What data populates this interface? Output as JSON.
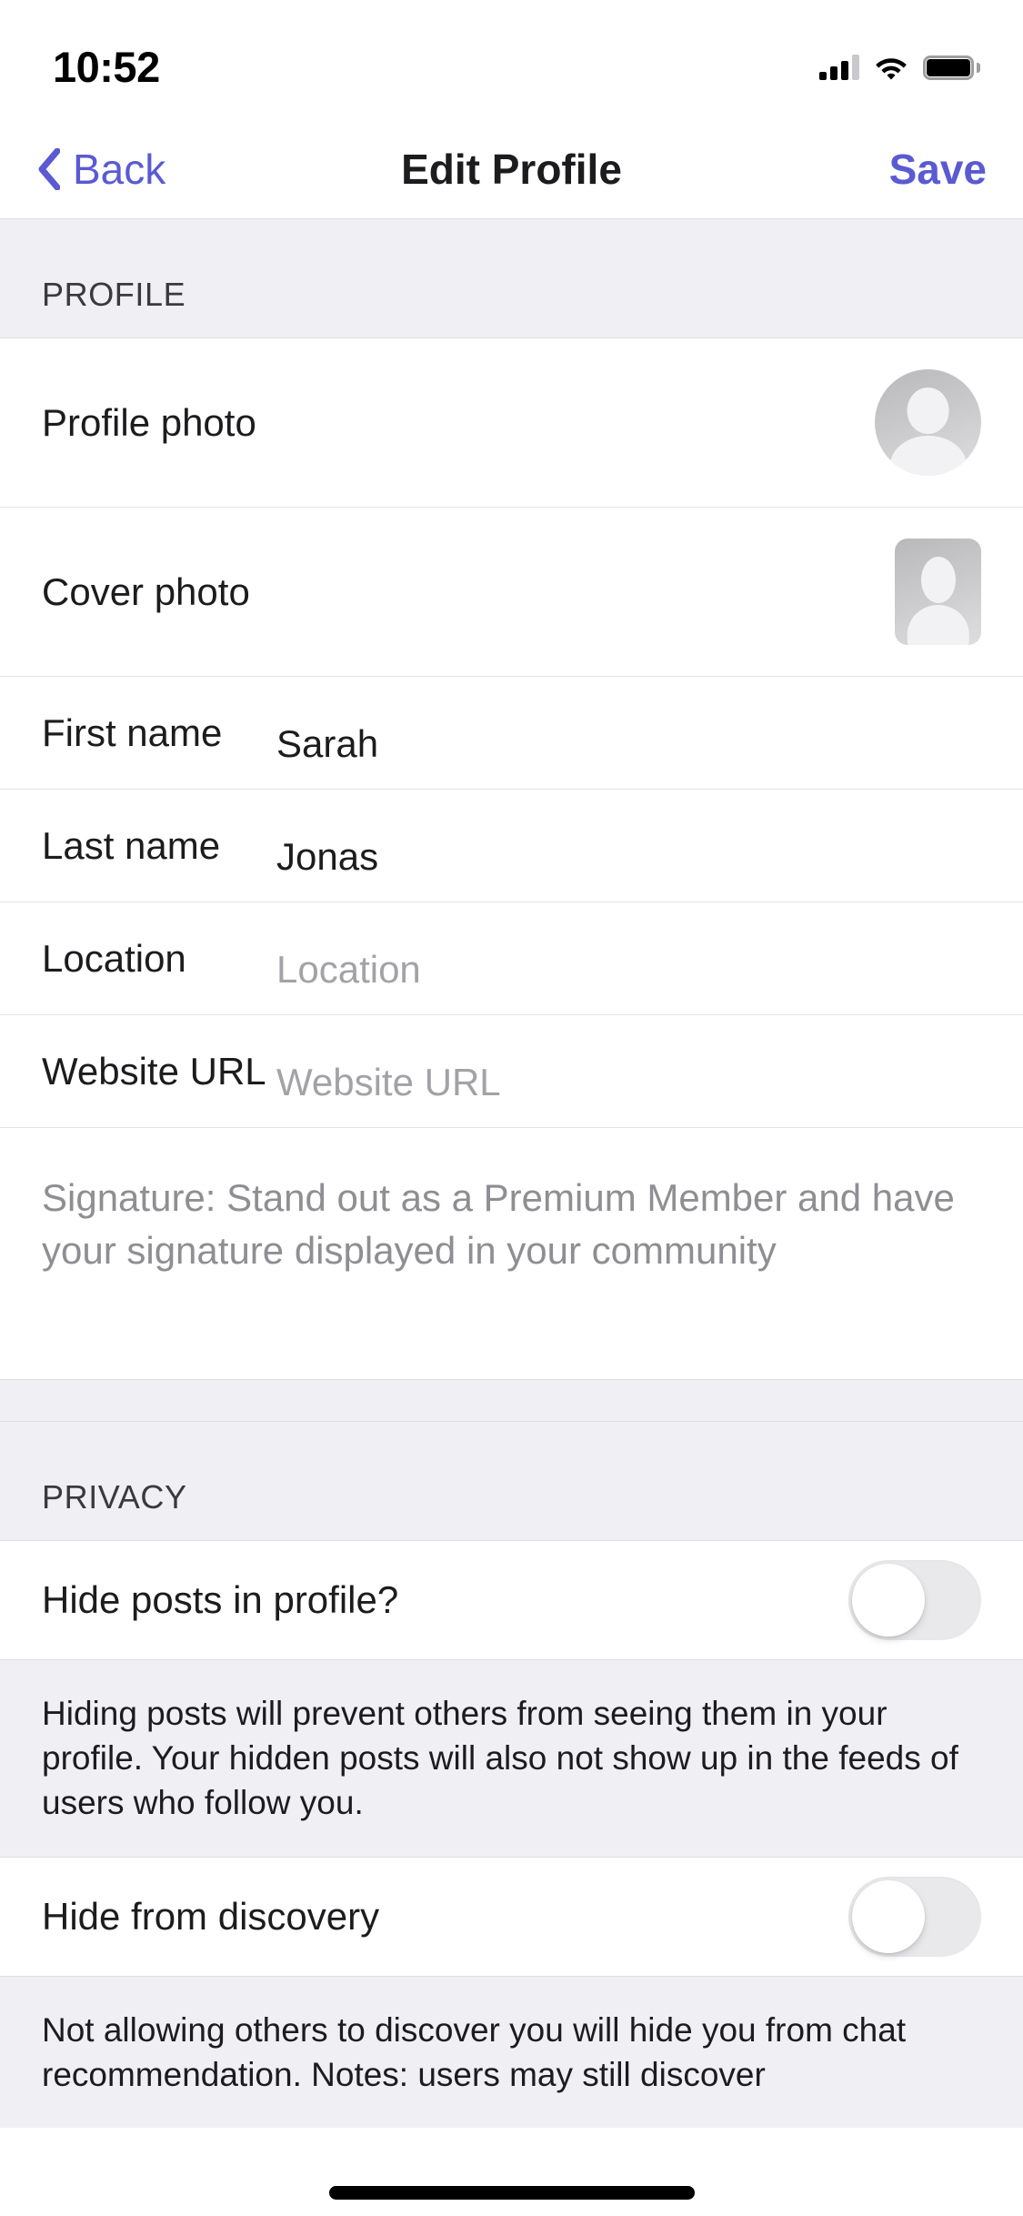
{
  "status_bar": {
    "time": "10:52",
    "signal_icon": "cellular-signal-icon",
    "wifi_icon": "wifi-icon",
    "battery_icon": "battery-full-icon"
  },
  "nav_bar": {
    "back_label": "Back",
    "back_icon": "chevron-left-icon",
    "title": "Edit Profile",
    "save_label": "Save",
    "accent_color": "#5a5ad2"
  },
  "profile_section": {
    "header": "PROFILE",
    "rows": [
      {
        "label": "Profile photo",
        "icon": "avatar-placeholder-circle-icon"
      },
      {
        "label": "Cover photo",
        "icon": "avatar-placeholder-rect-icon"
      }
    ],
    "fields": [
      {
        "label": "First name",
        "value": "Sarah",
        "placeholder": "First name"
      },
      {
        "label": "Last name",
        "value": "Jonas",
        "placeholder": "Last name"
      },
      {
        "label": "Location",
        "value": "",
        "placeholder": "Location"
      },
      {
        "label": "Website URL",
        "value": "",
        "placeholder": "Website URL"
      }
    ],
    "signature_placeholder": "Signature: Stand out as a Premium Member and have your signature displayed in your community"
  },
  "privacy_section": {
    "header": "PRIVACY",
    "items": [
      {
        "label": "Hide posts in profile?",
        "toggle_state": "off",
        "note": "Hiding posts will prevent others from seeing them in your profile. Your hidden posts will also not show up in the feeds of users who follow you."
      },
      {
        "label": "Hide from discovery",
        "toggle_state": "off",
        "note": "Not allowing others to discover you will hide you from chat recommendation. Notes: users may still discover"
      }
    ]
  },
  "colors": {
    "accent": "#5a5ad2",
    "group_background": "#f0eff4",
    "row_background": "#ffffff",
    "separator": "#e3e3e5",
    "placeholder_text": "#a2a2a7",
    "primary_text": "#1c1c1e"
  }
}
